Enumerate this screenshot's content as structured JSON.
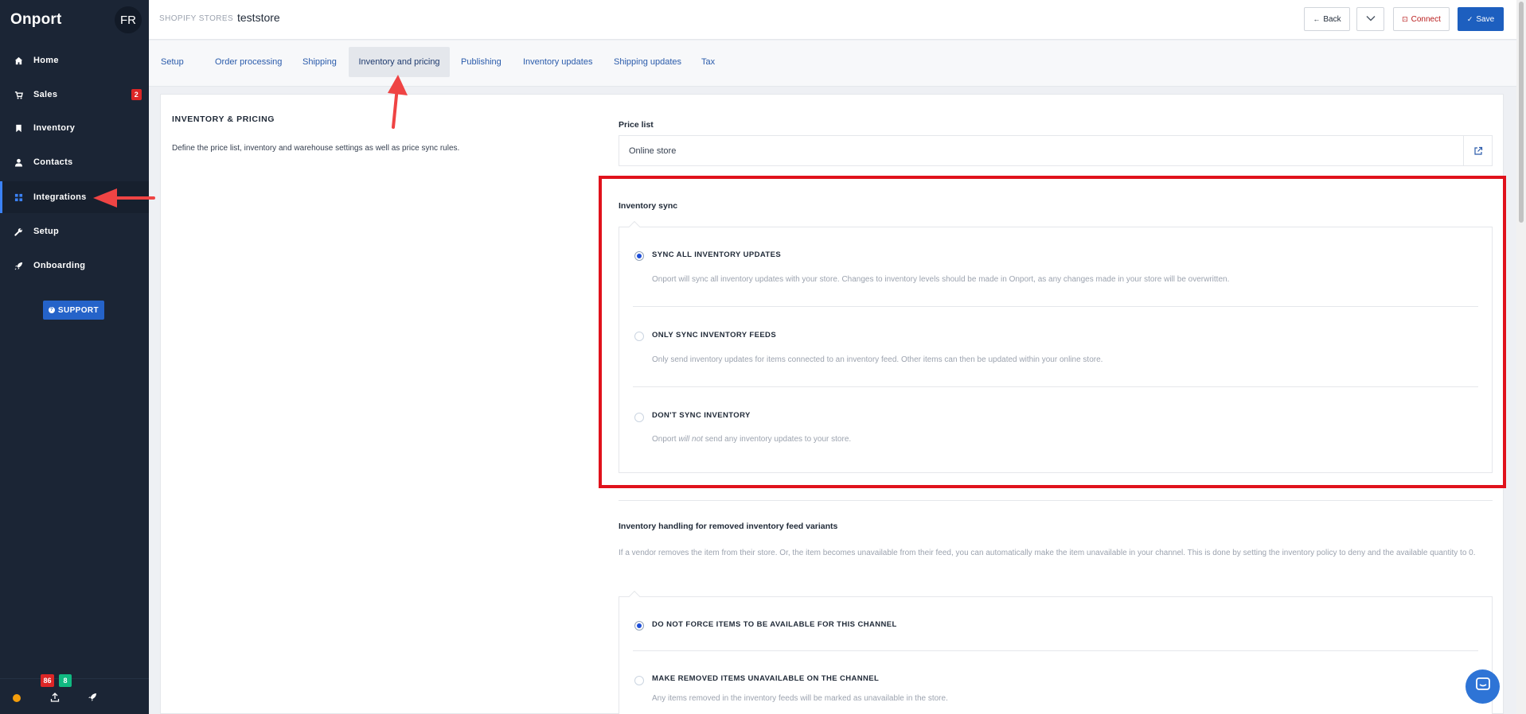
{
  "app": {
    "brand": "Onport",
    "user_initials": "FR"
  },
  "sidebar": {
    "items": [
      {
        "label": "Home",
        "icon": "home-icon"
      },
      {
        "label": "Sales",
        "icon": "cart-icon",
        "badge": "2"
      },
      {
        "label": "Inventory",
        "icon": "bookmark-icon"
      },
      {
        "label": "Contacts",
        "icon": "user-icon"
      },
      {
        "label": "Integrations",
        "icon": "grid-icon",
        "active": true
      },
      {
        "label": "Setup",
        "icon": "wrench-icon"
      },
      {
        "label": "Onboarding",
        "icon": "rocket-icon"
      }
    ],
    "support_label": "SUPPORT",
    "footer": {
      "badge_red": "86",
      "badge_green": "8"
    }
  },
  "header": {
    "breadcrumb_parent": "SHOPIFY STORES",
    "breadcrumb_sep": "/",
    "breadcrumb_current": "teststore",
    "back_label": "Back",
    "connect_label": "Connect",
    "save_label": "Save"
  },
  "tabs": [
    {
      "label": "Setup"
    },
    {
      "label": "Order processing"
    },
    {
      "label": "Shipping"
    },
    {
      "label": "Inventory and pricing",
      "active": true
    },
    {
      "label": "Publishing"
    },
    {
      "label": "Inventory updates"
    },
    {
      "label": "Shipping updates"
    },
    {
      "label": "Tax"
    }
  ],
  "section": {
    "title": "INVENTORY & PRICING",
    "description": "Define the price list, inventory and warehouse settings as well as price sync rules."
  },
  "price_list": {
    "label": "Price list",
    "value": "Online store"
  },
  "inventory_sync": {
    "label": "Inventory sync",
    "options": [
      {
        "label": "SYNC ALL INVENTORY UPDATES",
        "desc": "Onport will sync all inventory updates with your store. Changes to inventory levels should be made in Onport, as any changes made in your store will be overwritten.",
        "selected": true
      },
      {
        "label": "ONLY SYNC INVENTORY FEEDS",
        "desc": "Only send inventory updates for items connected to an inventory feed. Other items can then be updated within your online store.",
        "selected": false
      },
      {
        "label": "DON'T SYNC INVENTORY",
        "desc_before": "Onport ",
        "desc_em": "will not",
        "desc_after": " send any inventory updates to your store.",
        "selected": false
      }
    ]
  },
  "removed_handling": {
    "label": "Inventory handling for removed inventory feed variants",
    "desc": "If a vendor removes the item from their store. Or, the item becomes unavailable from their feed, you can automatically make the item unavailable in your channel. This is done by setting the inventory policy to deny and the available quantity to 0.",
    "options": [
      {
        "label": "DO NOT FORCE ITEMS TO BE AVAILABLE FOR THIS CHANNEL",
        "selected": true
      },
      {
        "label": "MAKE REMOVED ITEMS UNAVAILABLE ON THE CHANNEL",
        "desc": "Any items removed in the inventory feeds will be marked as unavailable in the store.",
        "selected": false
      }
    ]
  },
  "colors": {
    "sidebar_bg": "#1b2535",
    "accent": "#1d5fbf",
    "highlight": "#e0121c",
    "badge_red": "#dc2626",
    "badge_green": "#10b981"
  }
}
